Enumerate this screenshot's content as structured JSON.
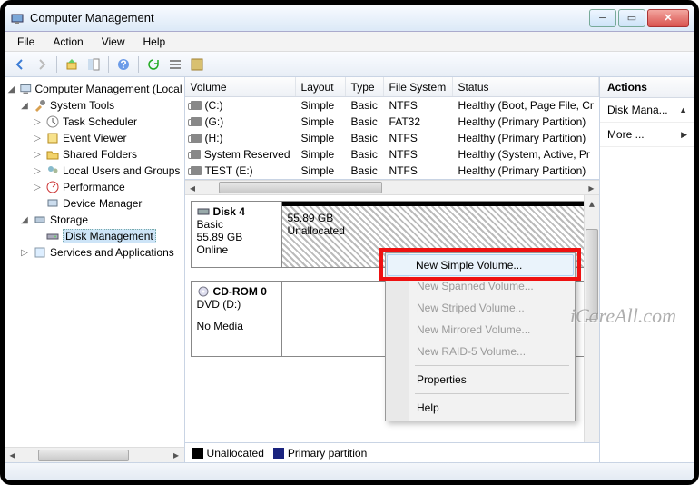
{
  "window": {
    "title": "Computer Management"
  },
  "menu": {
    "file": "File",
    "action": "Action",
    "view": "View",
    "help": "Help"
  },
  "tree": {
    "root": "Computer Management (Local",
    "system_tools": "System Tools",
    "task_scheduler": "Task Scheduler",
    "event_viewer": "Event Viewer",
    "shared_folders": "Shared Folders",
    "local_users": "Local Users and Groups",
    "performance": "Performance",
    "device_manager": "Device Manager",
    "storage": "Storage",
    "disk_management": "Disk Management",
    "services_apps": "Services and Applications"
  },
  "vol_headers": {
    "volume": "Volume",
    "layout": "Layout",
    "type": "Type",
    "fs": "File System",
    "status": "Status"
  },
  "volumes": [
    {
      "name": "(C:)",
      "layout": "Simple",
      "type": "Basic",
      "fs": "NTFS",
      "status": "Healthy (Boot, Page File, Cr"
    },
    {
      "name": "(G:)",
      "layout": "Simple",
      "type": "Basic",
      "fs": "FAT32",
      "status": "Healthy (Primary Partition)"
    },
    {
      "name": "(H:)",
      "layout": "Simple",
      "type": "Basic",
      "fs": "NTFS",
      "status": "Healthy (Primary Partition)"
    },
    {
      "name": "System Reserved",
      "layout": "Simple",
      "type": "Basic",
      "fs": "NTFS",
      "status": "Healthy (System, Active, Pr"
    },
    {
      "name": "TEST (E:)",
      "layout": "Simple",
      "type": "Basic",
      "fs": "NTFS",
      "status": "Healthy (Primary Partition)"
    }
  ],
  "disks": {
    "disk4": {
      "name": "Disk 4",
      "type": "Basic",
      "size": "55.89 GB",
      "status": "Online",
      "part_size": "55.89 GB",
      "part_status": "Unallocated"
    },
    "cdrom": {
      "name": "CD-ROM 0",
      "drive": "DVD (D:)",
      "status": "No Media"
    }
  },
  "legend": {
    "unallocated": "Unallocated",
    "primary": "Primary partition"
  },
  "actions": {
    "header": "Actions",
    "disk_mana": "Disk Mana...",
    "more": "More ..."
  },
  "context": {
    "new_simple": "New Simple Volume...",
    "new_spanned": "New Spanned Volume...",
    "new_striped": "New Striped Volume...",
    "new_mirrored": "New Mirrored Volume...",
    "new_raid5": "New RAID-5 Volume...",
    "properties": "Properties",
    "help": "Help"
  },
  "watermark": "iCareAll.com"
}
